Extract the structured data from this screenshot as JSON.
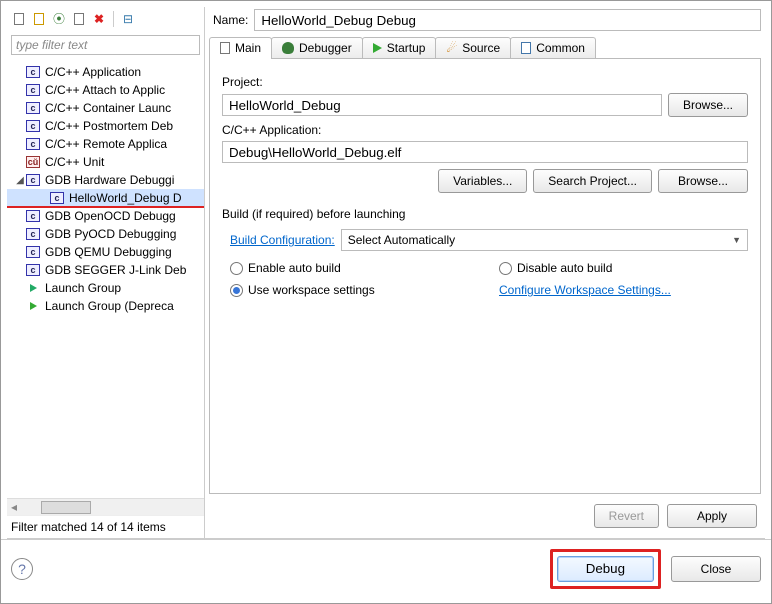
{
  "filterPlaceholder": "type filter text",
  "tree": {
    "items": [
      {
        "label": "C/C++ Application",
        "icon": "c"
      },
      {
        "label": "C/C++ Attach to Applic",
        "icon": "c"
      },
      {
        "label": "C/C++ Container Launc",
        "icon": "c"
      },
      {
        "label": "C/C++ Postmortem Deb",
        "icon": "c"
      },
      {
        "label": "C/C++ Remote Applica",
        "icon": "c"
      },
      {
        "label": "C/C++ Unit",
        "icon": "cu"
      },
      {
        "label": "GDB Hardware Debuggi",
        "icon": "c",
        "expanded": true
      },
      {
        "label": "HelloWorld_Debug D",
        "icon": "c",
        "selected": true,
        "indent": 2
      },
      {
        "label": "GDB OpenOCD Debugg",
        "icon": "c"
      },
      {
        "label": "GDB PyOCD Debugging",
        "icon": "c"
      },
      {
        "label": "GDB QEMU Debugging",
        "icon": "c"
      },
      {
        "label": "GDB SEGGER J-Link Deb",
        "icon": "c"
      },
      {
        "label": "Launch Group",
        "icon": "lg"
      },
      {
        "label": "Launch Group (Depreca",
        "icon": "lgd"
      }
    ],
    "footer": "Filter matched 14 of 14 items"
  },
  "nameLabel": "Name:",
  "nameValue": "HelloWorld_Debug Debug",
  "tabs": {
    "main": "Main",
    "debugger": "Debugger",
    "startup": "Startup",
    "source": "Source",
    "common": "Common"
  },
  "form": {
    "projectLabel": "Project:",
    "projectValue": "HelloWorld_Debug",
    "browse": "Browse...",
    "appLabel": "C/C++ Application:",
    "appValue": "Debug\\HelloWorld_Debug.elf",
    "variables": "Variables...",
    "searchProject": "Search Project...",
    "buildSection": "Build (if required) before launching",
    "buildConfigLabel": "Build Configuration:",
    "buildConfigValue": "Select Automatically",
    "enableAuto": "Enable auto build",
    "disableAuto": "Disable auto build",
    "useWorkspace": "Use workspace settings",
    "configureLink": "Configure Workspace Settings..."
  },
  "buttons": {
    "revert": "Revert",
    "apply": "Apply",
    "debug": "Debug",
    "close": "Close"
  }
}
